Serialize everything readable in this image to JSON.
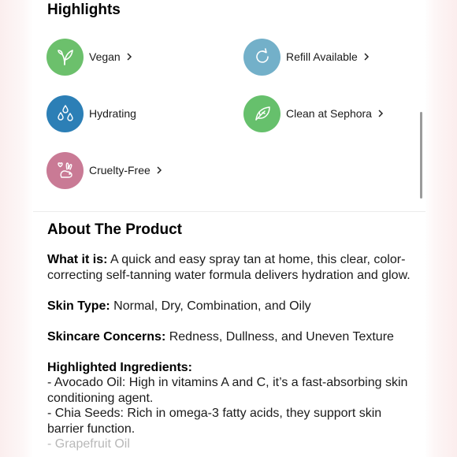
{
  "highlights": {
    "title": "Highlights",
    "items": [
      {
        "label": "Vegan",
        "icon": "sprout-icon",
        "color": "#6cc06c",
        "has_chevron": true
      },
      {
        "label": "Refill Available",
        "icon": "refill-icon",
        "color": "#73b0c9",
        "has_chevron": true
      },
      {
        "label": "Hydrating",
        "icon": "water-drops-icon",
        "color": "#2c7fb6",
        "has_chevron": false
      },
      {
        "label": "Clean at Sephora",
        "icon": "leaf-icon",
        "color": "#66c06c",
        "has_chevron": true
      },
      {
        "label": "Cruelty-Free",
        "icon": "bunny-icon",
        "color": "#c97a95",
        "has_chevron": true
      }
    ]
  },
  "about": {
    "title": "About The Product",
    "what_it_is_label": "What it is:",
    "what_it_is_text": " A quick and easy spray tan at home, this clear, color-correcting self-tanning water formula delivers hydration and glow.",
    "skin_type_label": "Skin Type:",
    "skin_type_text": " Normal, Dry, Combination, and Oily",
    "concerns_label": "Skincare Concerns:",
    "concerns_text": " Redness, Dullness, and Uneven Texture",
    "ingredients_label": "Highlighted Ingredients:",
    "ingredients": [
      "- Avocado Oil: High in vitamins A and C, it’s a fast-absorbing skin conditioning agent.",
      "- Chia Seeds: Rich in omega-3 fatty acids, they support skin barrier function.",
      "- Grapefruit Oil"
    ]
  },
  "colors": {
    "panel_bg": "#ffffff",
    "page_edge": "#fbeeee",
    "divider": "#ececec",
    "scrollbar": "#9b9b9b"
  }
}
